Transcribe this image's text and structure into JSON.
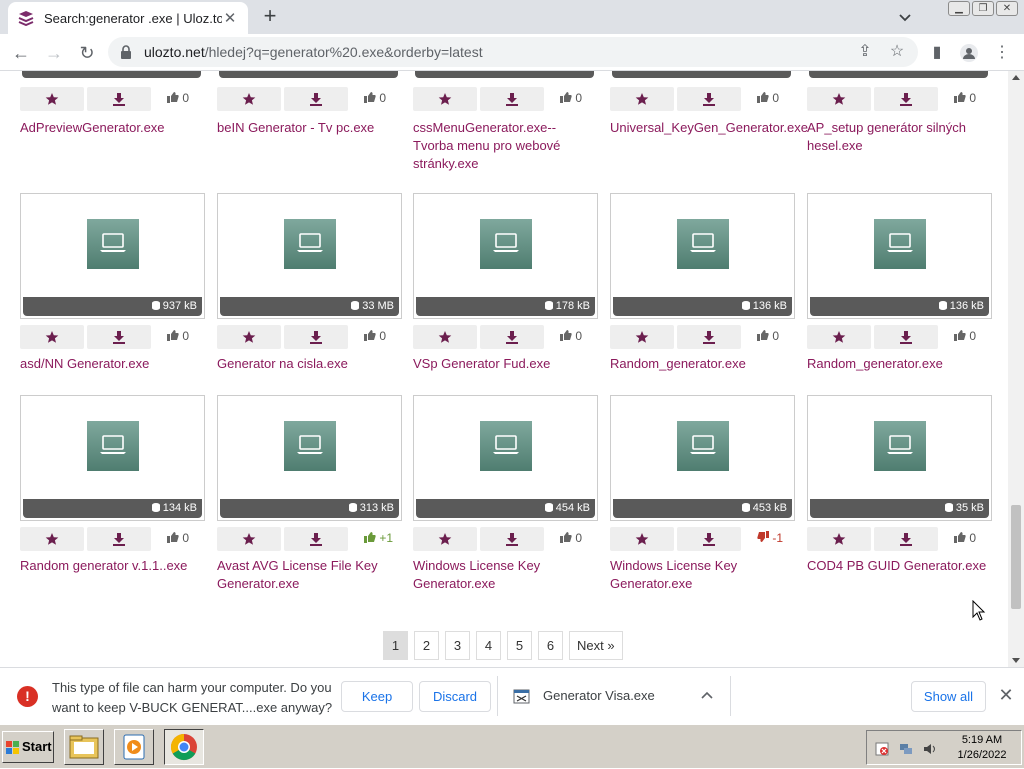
{
  "browser": {
    "tab_title": "Search:generator .exe | Uloz.to",
    "url_host": "ulozto.net",
    "url_path": "/hledej?q=generator%20.exe&orderby=latest"
  },
  "top_row": [
    {
      "name": "AdPreviewGenerator.exe",
      "votes": "0",
      "vote_type": "neutral"
    },
    {
      "name": "beIN Generator - Tv pc.exe",
      "votes": "0",
      "vote_type": "neutral"
    },
    {
      "name": "cssMenuGenerator.exe-- Tvorba menu pro webové stránky.exe",
      "votes": "0",
      "vote_type": "neutral"
    },
    {
      "name": "Universal_KeyGen_Generator.exe",
      "votes": "0",
      "vote_type": "neutral"
    },
    {
      "name": "AP_setup generátor silných hesel.exe",
      "votes": "0",
      "vote_type": "neutral"
    }
  ],
  "files": [
    {
      "size": "937 kB",
      "name": "asd/NN Generator.exe",
      "votes": "0",
      "vote_type": "neutral"
    },
    {
      "size": "33 MB",
      "name": "Generator na cisla.exe",
      "votes": "0",
      "vote_type": "neutral"
    },
    {
      "size": "178 kB",
      "name": "VSp Generator Fud.exe",
      "votes": "0",
      "vote_type": "neutral"
    },
    {
      "size": "136 kB",
      "name": "Random_generator.exe",
      "votes": "0",
      "vote_type": "neutral"
    },
    {
      "size": "136 kB",
      "name": "Random_generator.exe",
      "votes": "0",
      "vote_type": "neutral"
    },
    {
      "size": "134 kB",
      "name": "Random generator v.1.1..exe",
      "votes": "0",
      "vote_type": "neutral"
    },
    {
      "size": "313 kB",
      "name": "Avast AVG License File Key Generator.exe",
      "votes": "+1",
      "vote_type": "positive"
    },
    {
      "size": "454 kB",
      "name": "Windows License Key Generator.exe",
      "votes": "0",
      "vote_type": "neutral"
    },
    {
      "size": "453 kB",
      "name": "Windows License Key Generator.exe",
      "votes": "-1",
      "vote_type": "negative"
    },
    {
      "size": "35 kB",
      "name": "COD4 PB GUID Generator.exe",
      "votes": "0",
      "vote_type": "neutral"
    }
  ],
  "pagination": {
    "pages": [
      "1",
      "2",
      "3",
      "4",
      "5",
      "6"
    ],
    "current": "1",
    "next_label": "Next »"
  },
  "download_bar": {
    "warning": "This type of file can harm your computer. Do you want to keep V-BUCK GENERAT....exe anyway?",
    "keep_label": "Keep",
    "discard_label": "Discard",
    "item_name": "Generator Visa.exe",
    "show_all_label": "Show all"
  },
  "taskbar": {
    "start_label": "Start",
    "time": "5:19 AM",
    "date": "1/26/2022"
  },
  "colors": {
    "link": "#8b1a5c",
    "accent": "#6b1f4e",
    "size_bar": "#5a5a5a",
    "thumb_green": "#5f8a7e"
  }
}
